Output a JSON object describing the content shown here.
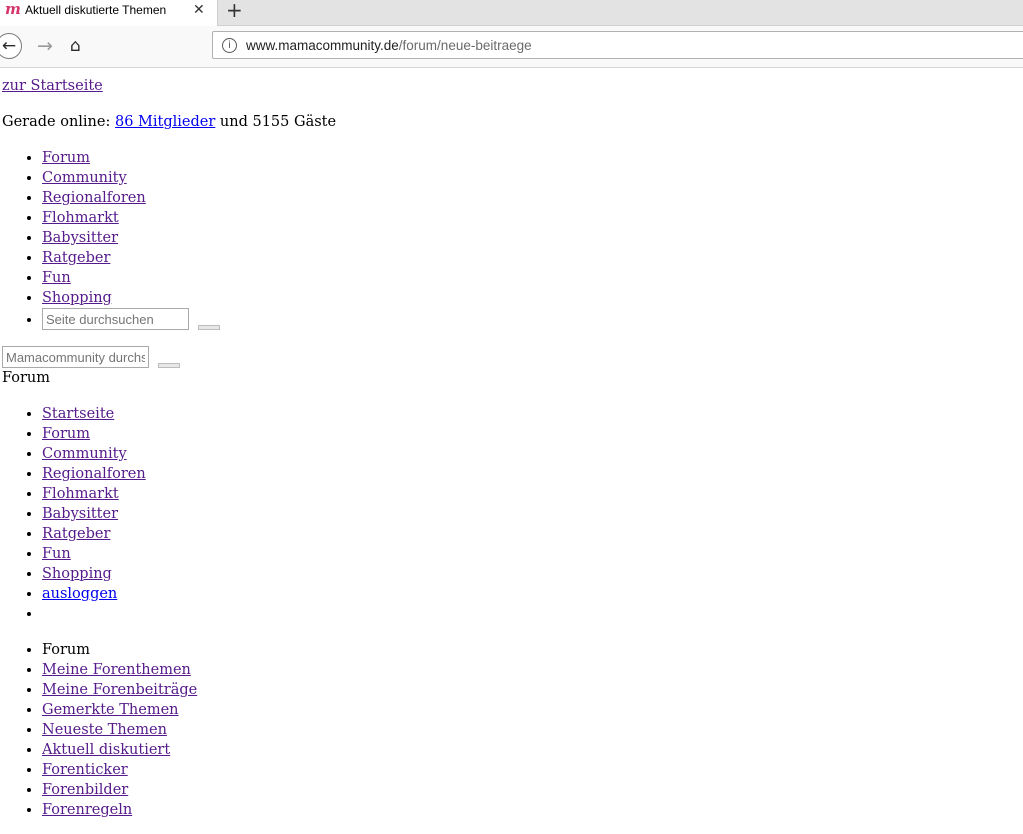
{
  "browser": {
    "tab_title": "Aktuell diskutierte Themen",
    "tab_close": "✕",
    "new_tab": "+",
    "favicon": "m",
    "url_host": "www.mamacommunity.de",
    "url_path": "/forum/neue-beitraege"
  },
  "page": {
    "home_link": "zur Startseite",
    "online_prefix": "Gerade online:",
    "online_members": "86 Mitglieder",
    "online_suffix": "und 5155 Gäste",
    "nav1": [
      "Forum",
      "Community",
      "Regionalforen",
      "Flohmarkt",
      "Babysitter",
      "Ratgeber",
      "Fun",
      "Shopping"
    ],
    "search1_placeholder": "Seite durchsuchen",
    "search2_placeholder": "Mamacommunity durchsuchen",
    "section_label": "Forum",
    "nav2": [
      "Startseite",
      "Forum",
      "Community",
      "Regionalforen",
      "Flohmarkt",
      "Babysitter",
      "Ratgeber",
      "Fun",
      "Shopping",
      "ausloggen"
    ],
    "nav3_heading": "Forum",
    "nav3": [
      "Meine Forenthemen",
      "Meine Forenbeiträge",
      "Gemerkte Themen",
      "Neueste Themen",
      "Aktuell diskutiert",
      "Forenticker",
      "Forenbilder",
      "Forenregeln"
    ]
  }
}
